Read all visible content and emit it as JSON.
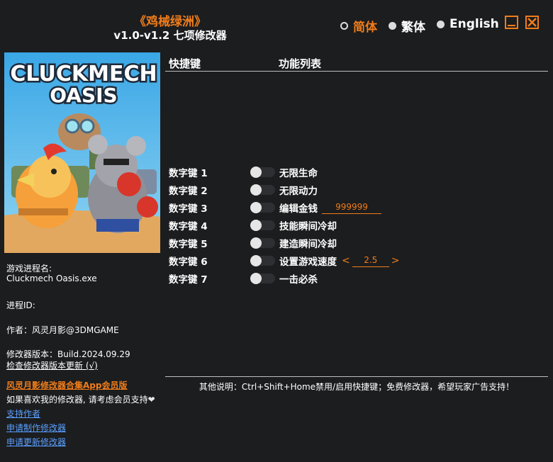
{
  "header": {
    "title": "《鸡械绿洲》",
    "subtitle": "v1.0-v1.2 七项修改器"
  },
  "languages": [
    {
      "label": "简体",
      "selected": true
    },
    {
      "label": "繁体",
      "selected": false
    },
    {
      "label": "English",
      "selected": false
    }
  ],
  "cover": {
    "logo_line1": "CLUCKMECH",
    "logo_line2": "OASIS"
  },
  "info": {
    "process_name_label": "游戏进程名:",
    "process_name_value": "Cluckmech Oasis.exe",
    "process_id_label": "进程ID:",
    "author": "作者：风灵月影@3DMGAME",
    "version": "修改器版本：Build.2024.09.29",
    "check_update": "检查修改器版本更新 (√)",
    "app_promo": "风灵月影修改器合集App会员版",
    "support_text": "如果喜欢我的修改器, 请考虑会员支持",
    "link_support": "支持作者",
    "link_request_make": "申请制作修改器",
    "link_request_update": "申请更新修改器"
  },
  "columns": {
    "hotkey": "快捷键",
    "functions": "功能列表"
  },
  "cheats": [
    {
      "key": "数字键 1",
      "name": "无限生命"
    },
    {
      "key": "数字键 2",
      "name": "无限动力"
    },
    {
      "key": "数字键 3",
      "name": "编辑金钱",
      "value": "999999"
    },
    {
      "key": "数字键 4",
      "name": "技能瞬间冷却"
    },
    {
      "key": "数字键 5",
      "name": "建造瞬间冷却"
    },
    {
      "key": "数字键 6",
      "name": "设置游戏速度",
      "value": "2.5"
    },
    {
      "key": "数字键 7",
      "name": "一击必杀"
    }
  ],
  "footer": {
    "note": "其他说明：Ctrl+Shift+Home禁用/启用快捷键；免费修改器，希望玩家广告支持！"
  },
  "colors": {
    "accent": "#f07d1a",
    "background": "#1c1d1f",
    "link": "#5aa0ff"
  },
  "icons": [
    "radio-icon",
    "minimize-icon",
    "close-icon",
    "heart-icon",
    "toggle-switch"
  ]
}
